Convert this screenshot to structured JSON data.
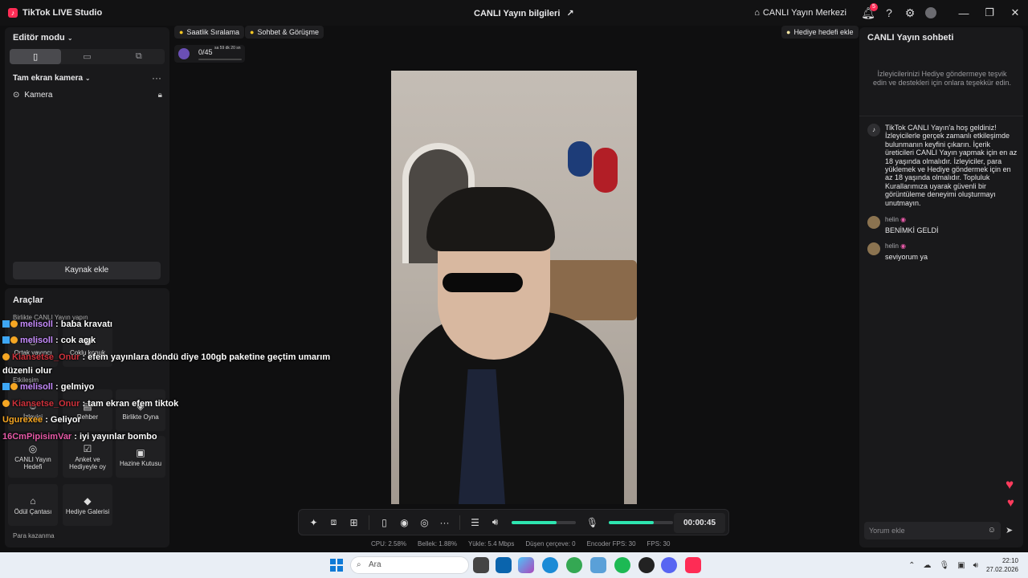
{
  "titlebar": {
    "app_title": "TikTok LIVE Studio",
    "live_info": "CANLI Yayın bilgileri",
    "live_center": "CANLI Yayın Merkezi",
    "notification_count": "5"
  },
  "left": {
    "editor_mode": "Editör modu",
    "scene_title": "Tam ekran kamera",
    "source_camera": "Kamera",
    "add_source": "Kaynak ekle",
    "tools_title": "Araçlar",
    "coop_label": "Birlikte CANLI Yayın yapın",
    "tools": [
      {
        "label": "Ortak yayıncı"
      },
      {
        "label": "Çoklu konuk"
      },
      {
        "label": "İzleyici"
      },
      {
        "label": "Rehber"
      },
      {
        "label": "Birlikte Oyna"
      },
      {
        "label": "CANLI Yayın Hedefi"
      },
      {
        "label": "Anket ve Hediyeyle oy"
      },
      {
        "label": "Hazine Kutusu"
      },
      {
        "label": "Ödül Çantası"
      },
      {
        "label": "Hediye Galerisi"
      }
    ],
    "interaction_label": "Etkileşim",
    "monetization_label": "Para kazanma"
  },
  "top_pills": {
    "hourly_rank": "Saatlik Sıralama",
    "chat_meet": "Sohbet & Görüşme",
    "gift_goal_add": "Hediye hedefi ekle"
  },
  "gift_goal": {
    "count": "0/45",
    "time": "sa 59 dk 20 sn",
    "progress": 0
  },
  "controls": {
    "speaker_level": 0.7,
    "mic_level": 0.7,
    "timer": "00:00:45"
  },
  "stats": {
    "cpu": "CPU:  2.58%",
    "memory": "Bellek:  1.88%",
    "upload": "Yükle:  5.4 Mbps",
    "dropped": "Düşen çerçeve:  0",
    "encoder_fps": "Encoder FPS:  30",
    "fps": "FPS:  30"
  },
  "chat": {
    "title": "CANLI Yayın sohbeti",
    "invite": "İzleyicilerinizi Hediye göndermeye teşvik edin ve destekleri için onlara teşekkür edin.",
    "system_message": "TikTok CANLI Yayın'a hoş geldiniz! İzleyicilerle gerçek zamanlı etkileşimde bulunmanın keyfini çıkarın. İçerik üreticileri CANLI Yayın yapmak için en az 18 yaşında olmalıdır. İzleyiciler, para yüklemek ve Hediye göndermek için en az 18 yaşında olmalıdır. Topluluk Kurallarımıza uyarak güvenli bir görüntüleme deneyimi oluşturmayı unutmayın.",
    "messages": [
      {
        "user": "helin",
        "text": "BENİMKİ GELDİ"
      },
      {
        "user": "helin",
        "text": "seviyorum ya"
      }
    ],
    "comment_placeholder": "Yorum ekle"
  },
  "overlay": [
    {
      "user": "melisoll",
      "msg": ": baba kravatı",
      "color": "#c78cff",
      "badges": true
    },
    {
      "user": "melisoll",
      "msg": ": cok açık",
      "color": "#c78cff",
      "badges": true
    },
    {
      "user": "Kiansetse_Onur",
      "msg": ": efem yayınlara döndü diye 100gb paketine geçtim umarım",
      "color": "#d0323c",
      "badges": "one"
    },
    {
      "user": "",
      "msg": "düzenli olur",
      "color": "#ffffff",
      "badges": false
    },
    {
      "user": "melisoll",
      "msg": ": gelmiyo",
      "color": "#c78cff",
      "badges": true
    },
    {
      "user": "Kiansetse_Onur",
      "msg": ": tam ekran efem tiktok",
      "color": "#d0323c",
      "badges": "one"
    },
    {
      "user": "Ugurexee",
      "msg": ": Geliyor",
      "color": "#f5a623",
      "badges": false
    },
    {
      "user": "16CmPipisimVar",
      "msg": ": iyi yayınlar bombo",
      "color": "#e85aa8",
      "badges": false
    }
  ],
  "taskbar": {
    "search_placeholder": "Ara",
    "time": "22:10",
    "date": "27.02.2026"
  }
}
